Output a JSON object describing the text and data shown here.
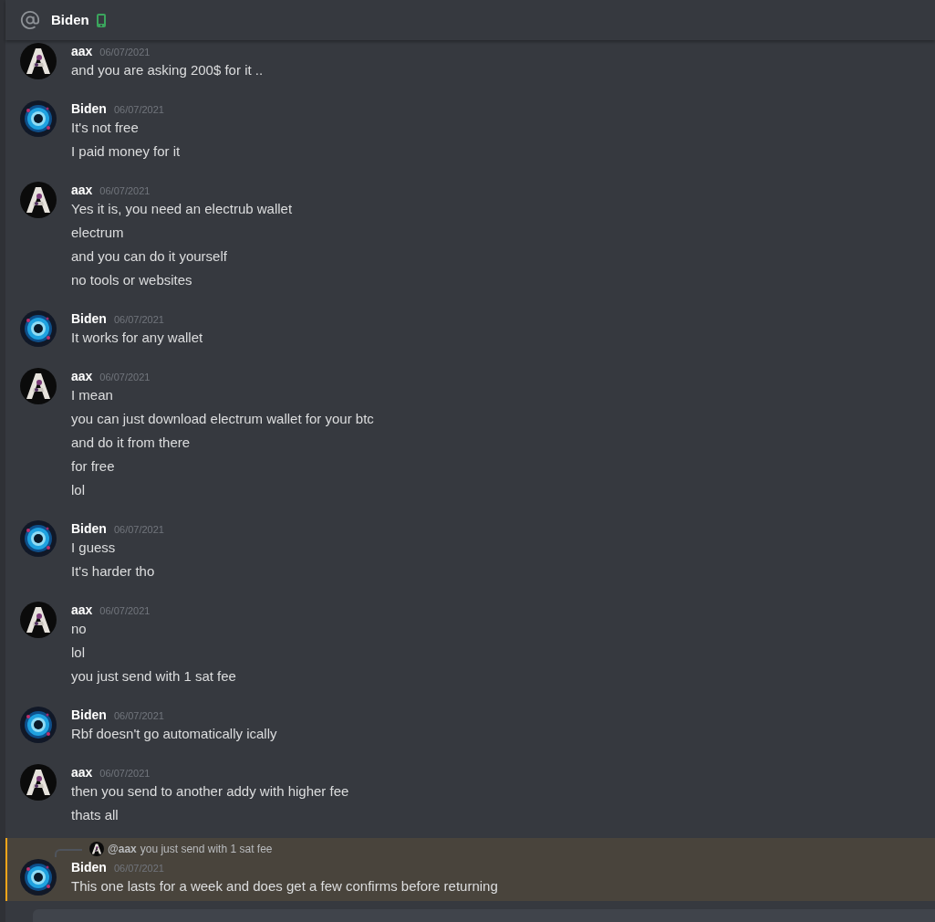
{
  "header": {
    "title": "Biden",
    "mobile": true
  },
  "messages": [
    {
      "author": "aax",
      "time": "06/07/2021",
      "kind": "monogram",
      "highlighted": false,
      "lines": [
        "and you are asking 200$ for it .."
      ]
    },
    {
      "author": "Biden",
      "time": "06/07/2021",
      "kind": "vortex",
      "highlighted": false,
      "lines": [
        "It's not free",
        "I paid money for it"
      ]
    },
    {
      "author": "aax",
      "time": "06/07/2021",
      "kind": "monogram",
      "highlighted": false,
      "lines": [
        "Yes it is, you need an electrub wallet",
        "electrum",
        "and you can do it yourself",
        "no tools or websites"
      ]
    },
    {
      "author": "Biden",
      "time": "06/07/2021",
      "kind": "vortex",
      "highlighted": false,
      "lines": [
        "It works for any wallet"
      ]
    },
    {
      "author": "aax",
      "time": "06/07/2021",
      "kind": "monogram",
      "highlighted": false,
      "lines": [
        "I mean",
        "you can just download electrum wallet for your btc",
        "and do it from there",
        "for free",
        "lol"
      ]
    },
    {
      "author": "Biden",
      "time": "06/07/2021",
      "kind": "vortex",
      "highlighted": false,
      "lines": [
        "I guess",
        "It's harder tho"
      ]
    },
    {
      "author": "aax",
      "time": "06/07/2021",
      "kind": "monogram",
      "highlighted": false,
      "lines": [
        "no",
        "lol",
        "you just send with 1 sat fee"
      ]
    },
    {
      "author": "Biden",
      "time": "06/07/2021",
      "kind": "vortex",
      "highlighted": false,
      "lines": [
        "Rbf doesn't go automatically ically"
      ]
    },
    {
      "author": "aax",
      "time": "06/07/2021",
      "kind": "monogram",
      "highlighted": false,
      "lines": [
        "then you send to another addy with higher fee",
        "thats all"
      ]
    },
    {
      "author": "Biden",
      "time": "06/07/2021",
      "kind": "vortex",
      "highlighted": true,
      "reply": {
        "author": "@aax",
        "kind": "monogram",
        "text": "you just send with 1 sat fee"
      },
      "lines": [
        "This one lasts for a week and does get a few confirms before returning"
      ]
    }
  ]
}
